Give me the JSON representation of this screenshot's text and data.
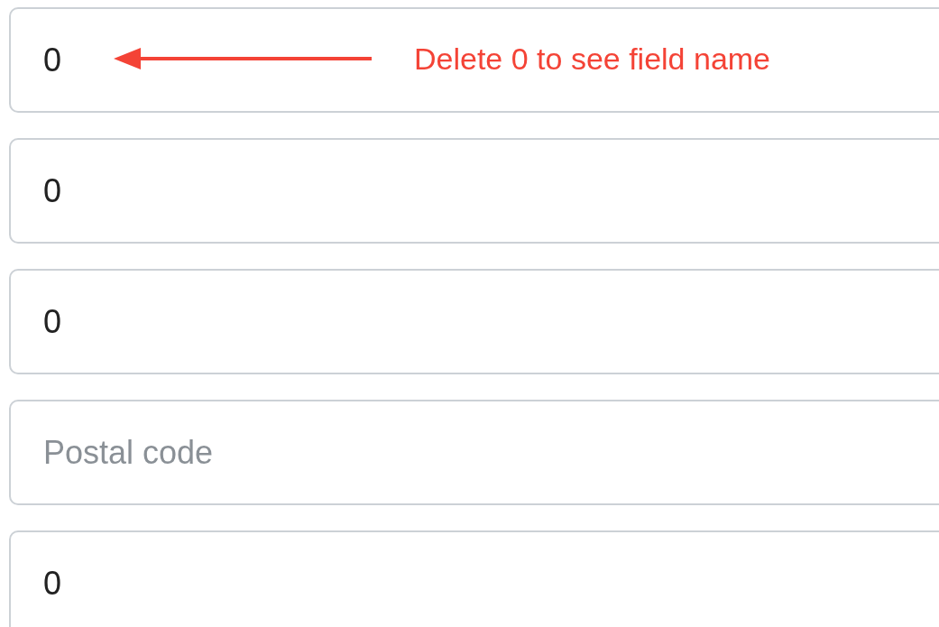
{
  "fields": [
    {
      "value": "0"
    },
    {
      "value": "0"
    },
    {
      "value": "0"
    },
    {
      "placeholder": "Postal code"
    },
    {
      "value": "0"
    }
  ],
  "annotation": {
    "text": "Delete 0 to see field name"
  }
}
